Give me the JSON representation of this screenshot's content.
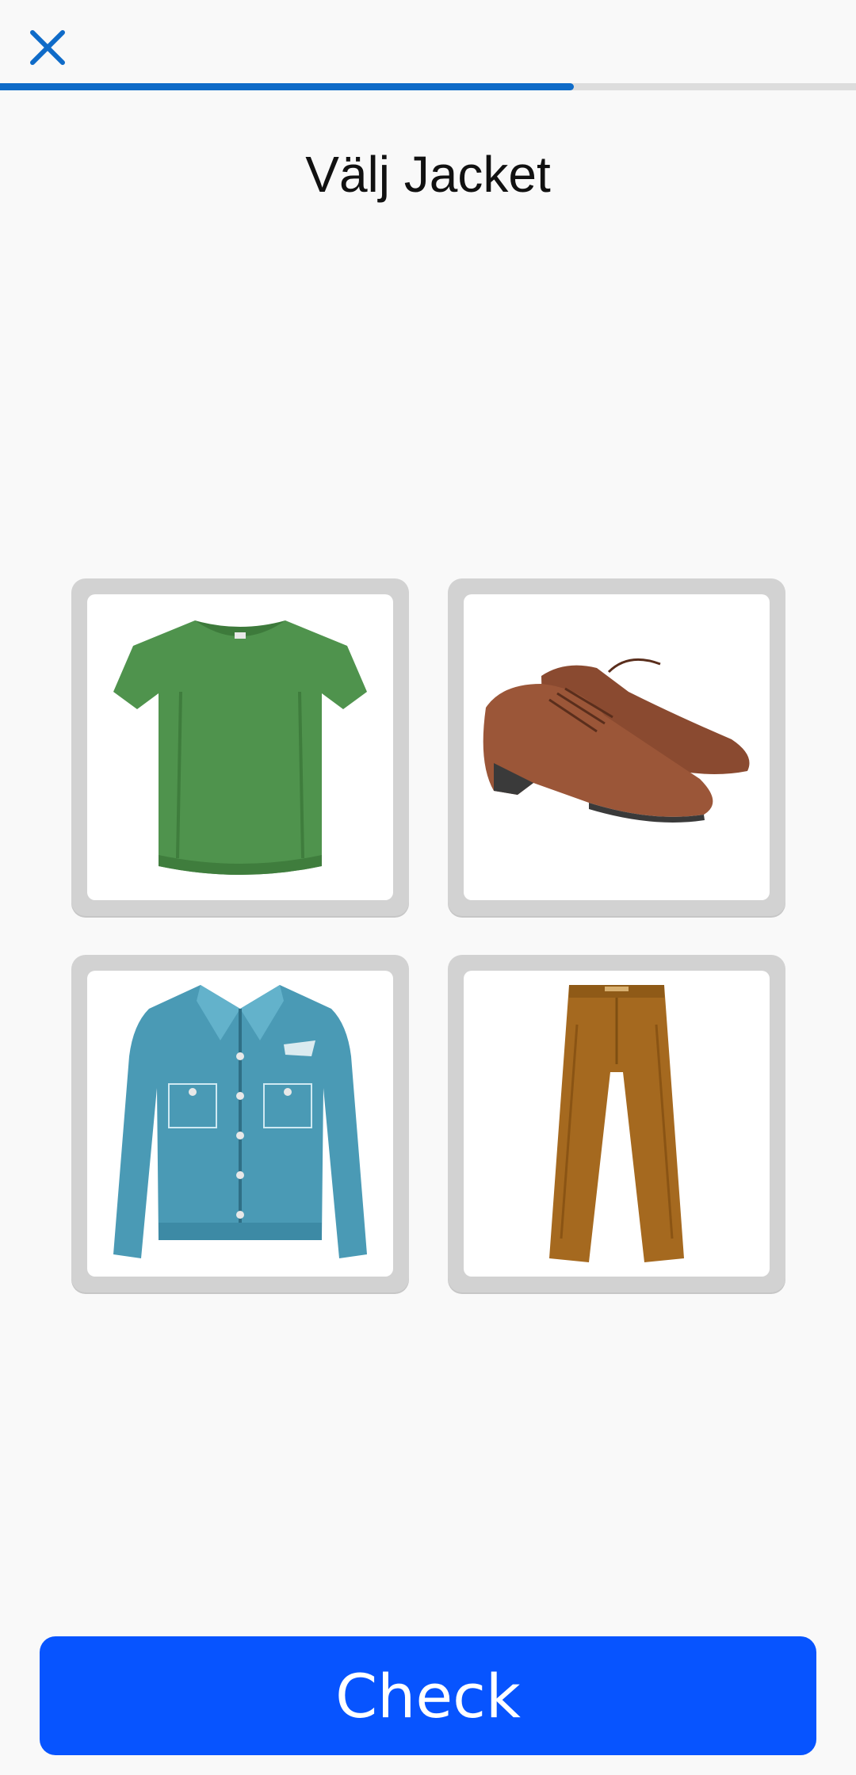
{
  "header": {
    "close_icon": "close-icon",
    "progress_fraction": 0.67,
    "colors": {
      "progress": "#0f6bc8",
      "progress_track": "#dddddd",
      "close": "#0f6bc8"
    }
  },
  "prompt": {
    "title": "Välj Jacket"
  },
  "options": [
    {
      "id": "tshirt",
      "icon": "green-tshirt-image"
    },
    {
      "id": "shoes",
      "icon": "brown-shoes-image"
    },
    {
      "id": "jacket",
      "icon": "denim-jacket-image"
    },
    {
      "id": "pants",
      "icon": "brown-pants-image"
    }
  ],
  "footer": {
    "check_label": "Check",
    "color": "#0754ff"
  }
}
